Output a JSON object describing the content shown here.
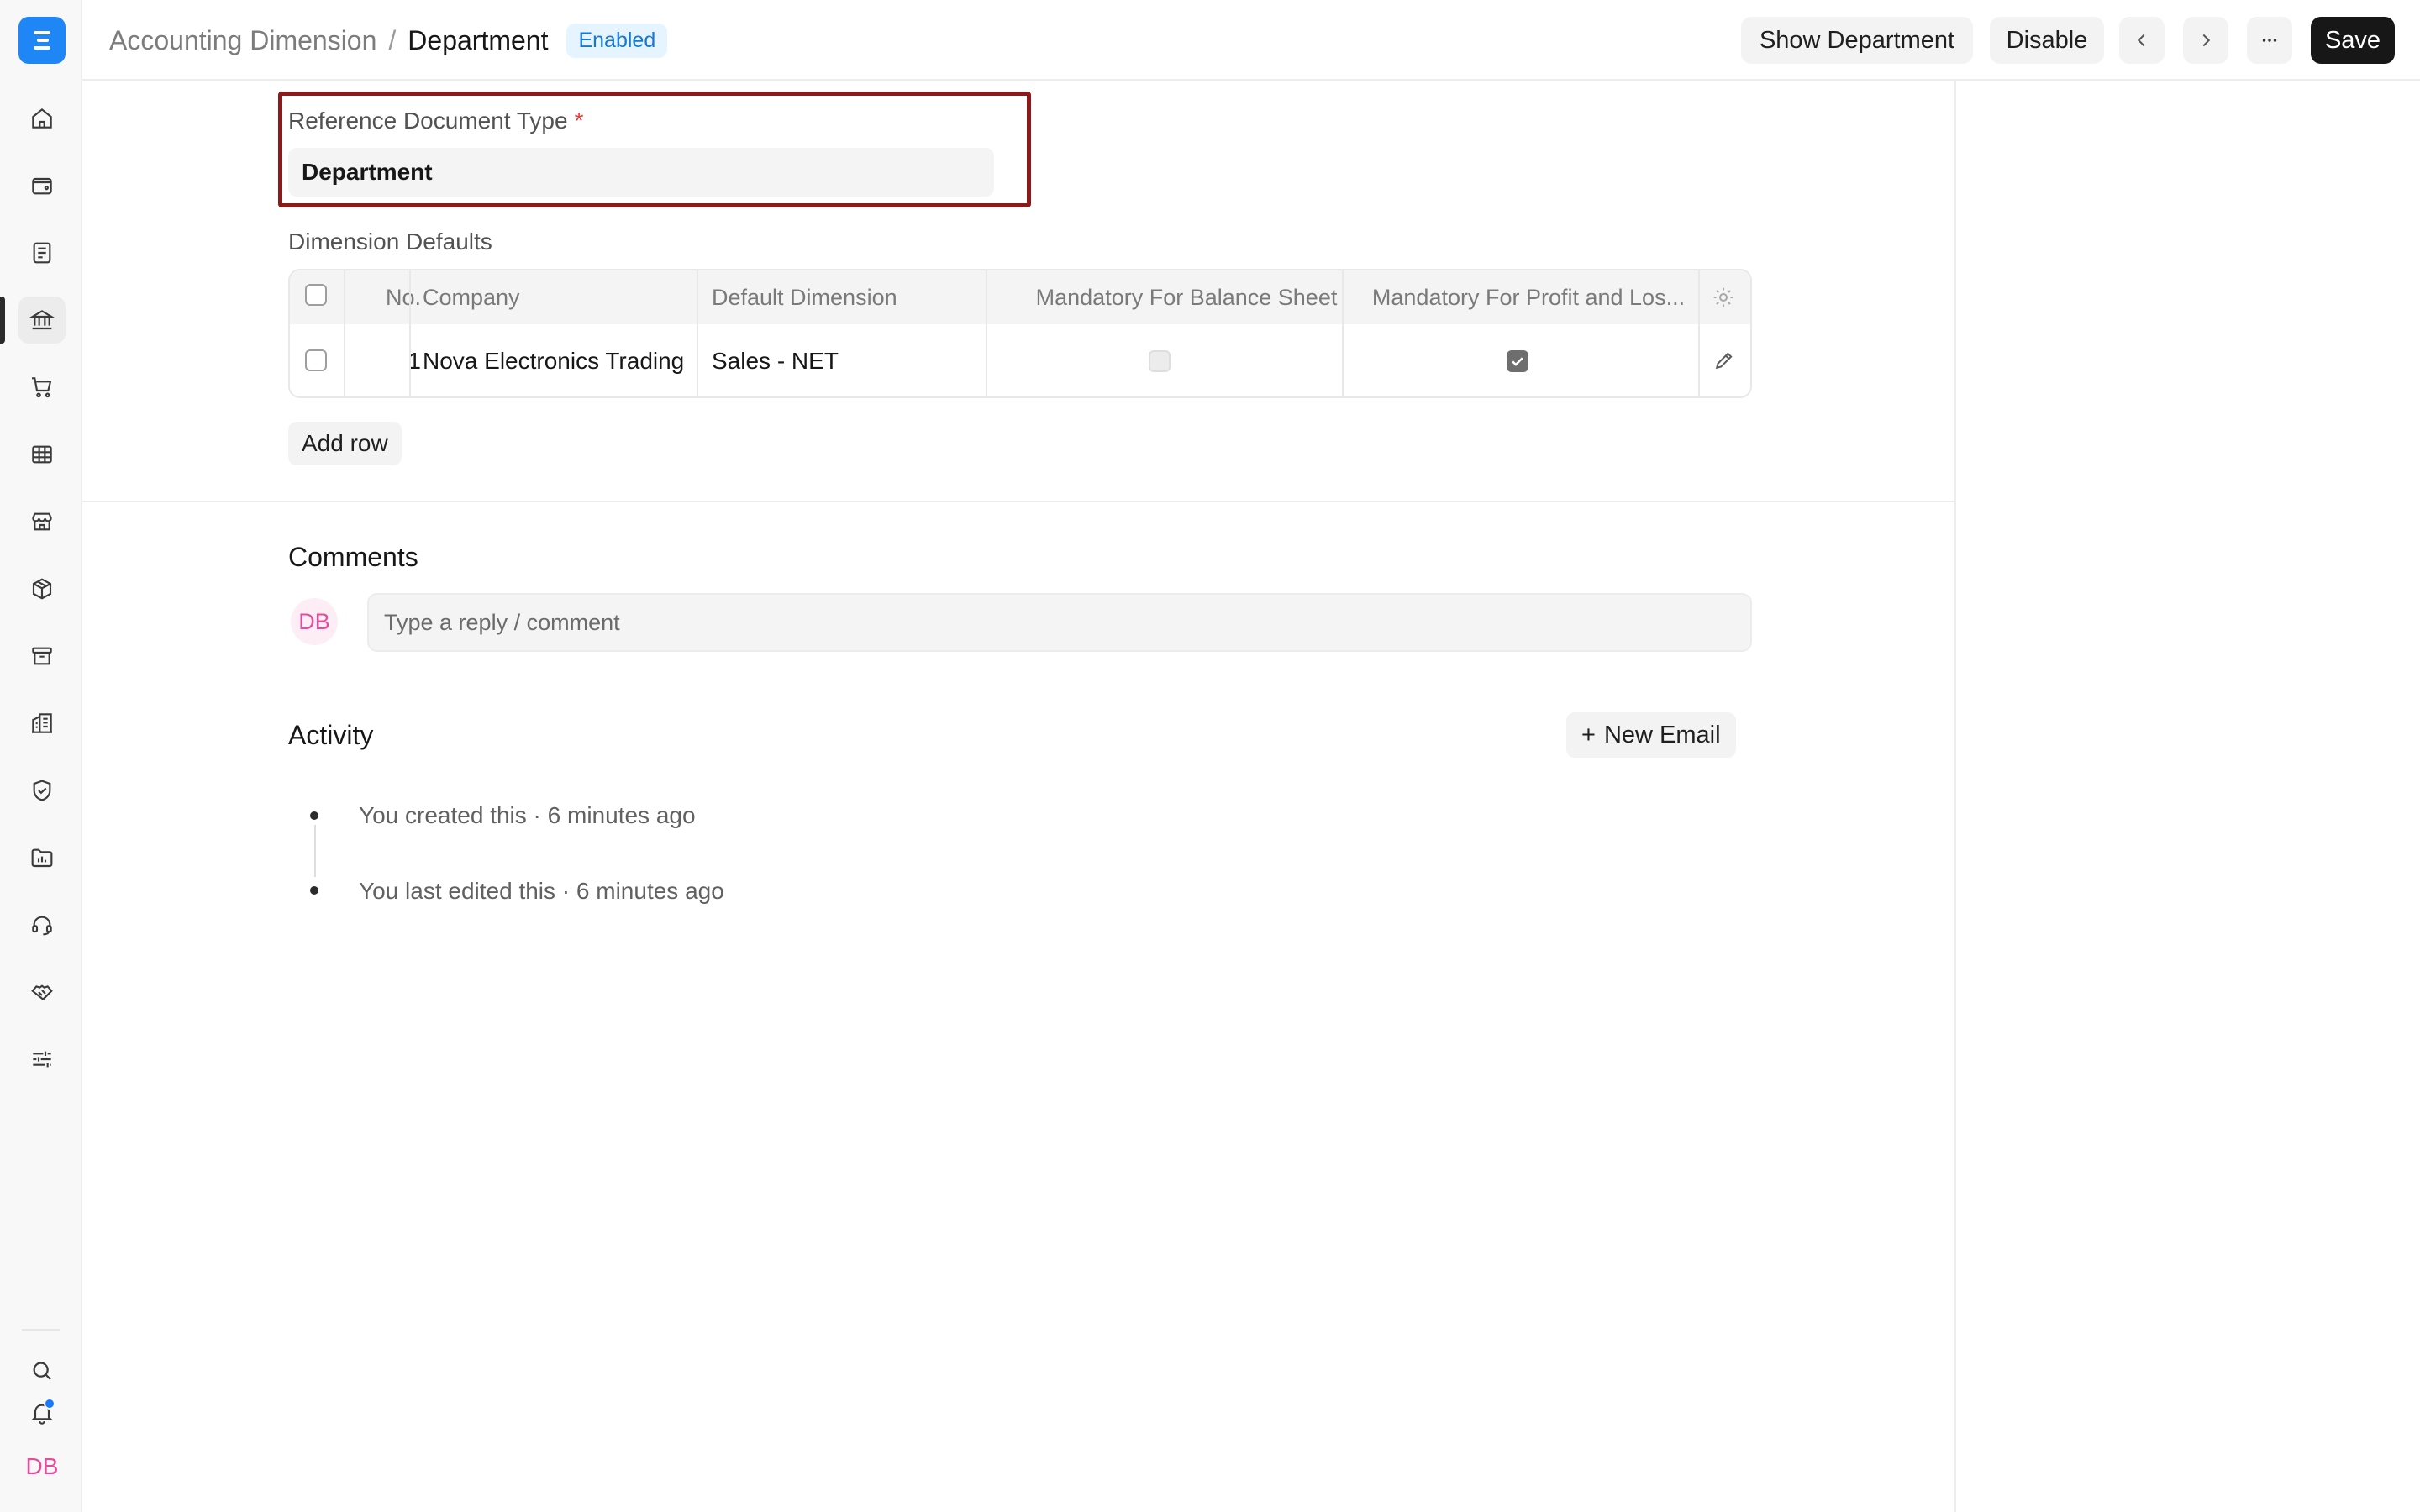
{
  "app": {
    "logo_icon": "frappe-logo",
    "accent": "#1e86f5"
  },
  "sidebar": {
    "items": [
      {
        "icon": "home-icon"
      },
      {
        "icon": "wallet-icon"
      },
      {
        "icon": "document-icon"
      },
      {
        "icon": "bank-icon",
        "active": true
      },
      {
        "icon": "cart-icon"
      },
      {
        "icon": "table-icon"
      },
      {
        "icon": "store-icon"
      },
      {
        "icon": "package-icon"
      },
      {
        "icon": "archive-icon"
      },
      {
        "icon": "building-icon"
      },
      {
        "icon": "shield-icon"
      },
      {
        "icon": "folder-chart-icon"
      },
      {
        "icon": "headset-icon"
      },
      {
        "icon": "handshake-icon"
      },
      {
        "icon": "sliders-icon"
      }
    ],
    "bottom": {
      "search_icon": "search-icon",
      "notification_icon": "bell-icon",
      "avatar_initials": "DB"
    }
  },
  "header": {
    "breadcrumb_parent": "Accounting Dimension",
    "breadcrumb_sep": "/",
    "title": "Department",
    "status_badge": "Enabled",
    "buttons": {
      "show": "Show Department",
      "disable": "Disable",
      "save": "Save"
    }
  },
  "form": {
    "reference_label": "Reference Document Type",
    "required_mark": "*",
    "reference_value": "Department",
    "dimension_defaults_label": "Dimension Defaults"
  },
  "table": {
    "headers": {
      "no": "No.",
      "company": "Company",
      "default_dimension": "Default Dimension",
      "mandatory_bs": "Mandatory For Balance Sheet",
      "mandatory_pl": "Mandatory For Profit and Los..."
    },
    "rows": [
      {
        "no": "1",
        "company": "Nova Electronics Trading",
        "default_dimension": "Sales - NET",
        "mandatory_bs": false,
        "mandatory_pl": true
      }
    ],
    "add_row": "Add row"
  },
  "comments": {
    "title": "Comments",
    "avatar": "DB",
    "placeholder": "Type a reply / comment"
  },
  "activity": {
    "title": "Activity",
    "new_email": "New Email",
    "plus": "+",
    "items": [
      "You created this · 6 minutes ago",
      "You last edited this · 6 minutes ago"
    ]
  }
}
